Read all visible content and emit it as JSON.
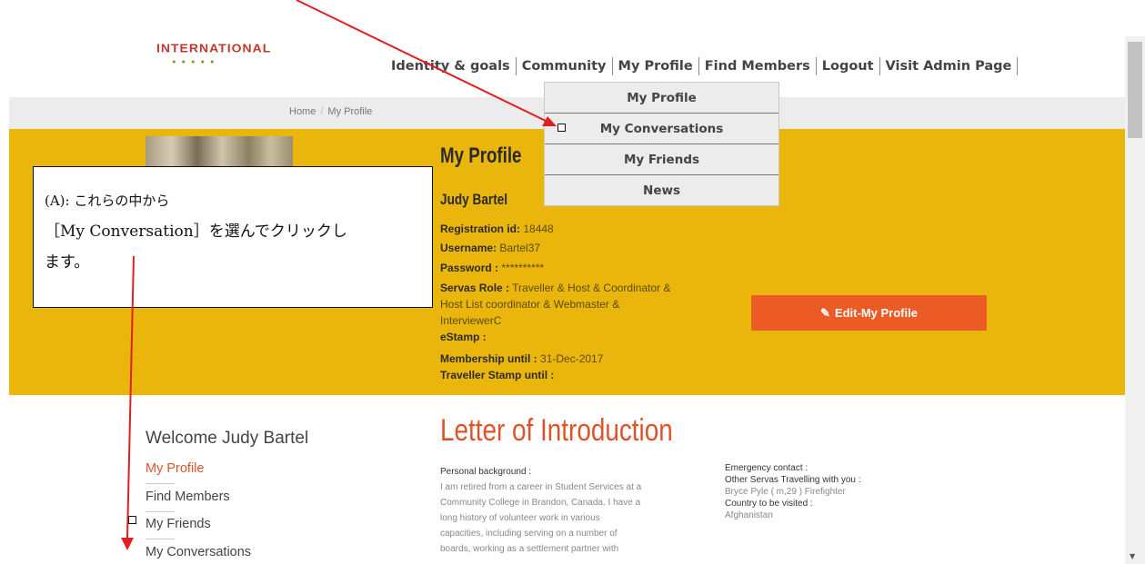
{
  "header": {
    "logo_text": "INTERNATIONAL",
    "logo_dots": "•••••",
    "nav": [
      "Identity & goals",
      "Community",
      "My Profile",
      "Find Members",
      "Logout",
      "Visit Admin Page"
    ]
  },
  "breadcrumb": {
    "home": "Home",
    "separator": "/",
    "current": "My Profile"
  },
  "dropdown": {
    "items": [
      "My Profile",
      "My Conversations",
      "My Friends",
      "News"
    ]
  },
  "profile": {
    "title": "My Profile",
    "name": "Judy Bartel",
    "fields": {
      "registration_label": "Registration id:",
      "registration_value": "18448",
      "username_label": "Username:",
      "username_value": "Bartel37",
      "password_label": "Password :",
      "password_value": "**********",
      "role_label": "Servas Role :",
      "role_line1": "Traveller & Host & Coordinator &",
      "role_line2": "Host List coordinator & Webmaster &",
      "role_line3": "InterviewerC",
      "estamp_label": "eStamp :",
      "membership_label": "Membership until :",
      "membership_value": "31-Dec-2017",
      "traveller_stamp_label": "Traveller Stamp until :"
    },
    "edit_button": "Edit-My Profile"
  },
  "callout": {
    "line1": "(A): これらの中から",
    "line2": "［My Conversation］を選んでクリックし",
    "line3": "ます。"
  },
  "sidebar": {
    "welcome": "Welcome Judy Bartel",
    "links": [
      "My Profile",
      "Find Members",
      "My Friends",
      "My Conversations"
    ]
  },
  "letter": {
    "title": "Letter of Introduction",
    "personal_background_label": "Personal background :",
    "personal_background_lines": [
      "I am retired from a career in Student Services at a",
      "Community College in Brandon, Canada. I have a",
      "long history of volunteer work in various",
      "capacities, including serving on a number of",
      "boards, working as a settlement partner with"
    ],
    "emergency_contact_label": "Emergency contact :",
    "other_travelling_label": "Other Servas Travelling with you :",
    "other_travelling_value": "Bryce Pyle ( m,29 ) Firefighter",
    "country_label": "Country to be visited :",
    "country_value": "Afghanistan"
  },
  "colors": {
    "band": "#ebb60c",
    "accent": "#e0532a",
    "button": "#ec5a26",
    "arrow": "#e02020"
  },
  "icons": [
    "pencil-icon",
    "scroll-down-arrow-icon"
  ]
}
